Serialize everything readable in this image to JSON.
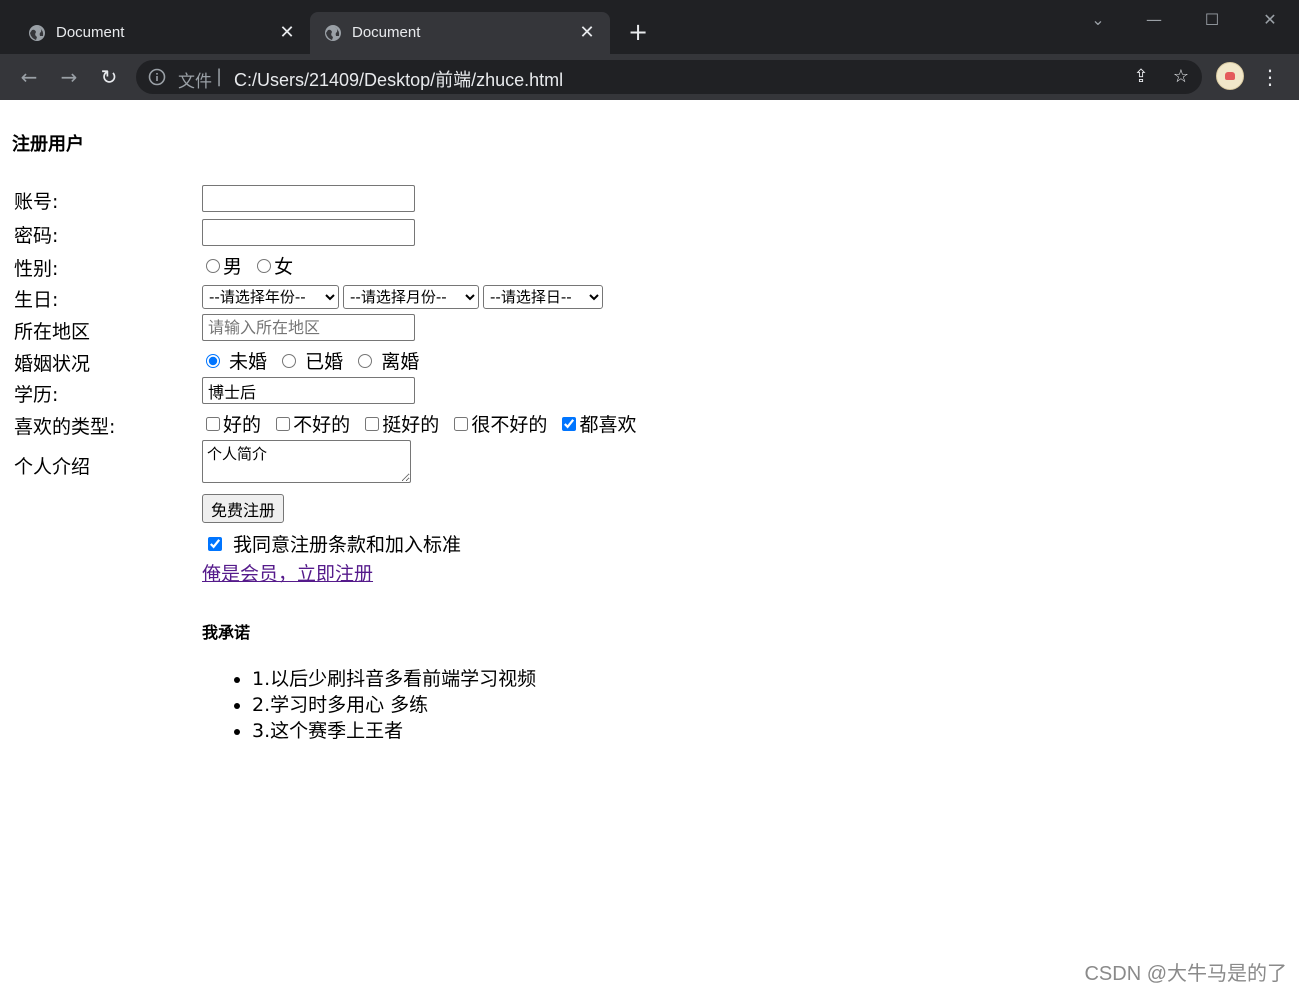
{
  "browser": {
    "tabs": [
      {
        "title": "Document",
        "active": false
      },
      {
        "title": "Document",
        "active": true
      }
    ],
    "address": {
      "scheme_label": "文件",
      "url": "C:/Users/21409/Desktop/前端/zhuce.html"
    },
    "icons": {
      "tab_favicon": "globe-icon",
      "back": "arrow-left-icon",
      "forward": "arrow-right-icon",
      "reload": "reload-icon",
      "info": "info-icon",
      "share": "share-icon",
      "bookmark": "star-icon",
      "menu": "kebab-menu-icon"
    },
    "colors": {
      "frame": "#202124",
      "toolbar": "#35363a",
      "text": "#e8eaed"
    }
  },
  "form": {
    "title": "注册用户",
    "account": {
      "label": "账号:",
      "value": ""
    },
    "password": {
      "label": "密码:",
      "value": ""
    },
    "gender": {
      "label": "性别:",
      "options": [
        "男",
        "女"
      ],
      "selected": null
    },
    "birthday": {
      "label": "生日:",
      "year": "--请选择年份--",
      "month": "--请选择月份--",
      "day": "--请选择日--"
    },
    "region": {
      "label": "所在地区",
      "placeholder": "请输入所在地区"
    },
    "marital": {
      "label": "婚姻状况",
      "options": [
        "未婚",
        "已婚",
        "离婚"
      ],
      "selected": "未婚"
    },
    "education": {
      "label": "学历:",
      "value": "博士后"
    },
    "types": {
      "label": "喜欢的类型:",
      "options": [
        "好的",
        "不好的",
        "挺好的",
        "很不好的",
        "都喜欢"
      ],
      "checked": [
        "都喜欢"
      ]
    },
    "intro": {
      "label": "个人介绍",
      "placeholder": "个人简介"
    },
    "register_button": "免费注册",
    "agree": {
      "label": "我同意注册条款和加入标准",
      "checked": true
    },
    "member_link": "俺是会员，立即注册",
    "promise_title": "我承诺",
    "promises": [
      "1.以后少刷抖音多看前端学习视频",
      "2.学习时多用心 多练",
      "3.这个赛季上王者"
    ]
  },
  "watermark": "CSDN @大牛马是的了"
}
